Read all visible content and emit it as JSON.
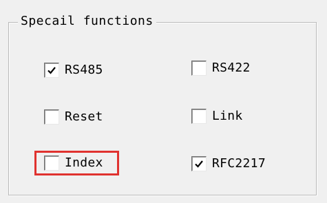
{
  "group": {
    "title": "Specail functions"
  },
  "checkboxes": [
    {
      "id": "rs485",
      "label": "RS485",
      "checked": true
    },
    {
      "id": "rs422",
      "label": "RS422",
      "checked": false
    },
    {
      "id": "reset",
      "label": "Reset",
      "checked": false
    },
    {
      "id": "link",
      "label": "Link",
      "checked": false
    },
    {
      "id": "index",
      "label": "Index",
      "checked": false
    },
    {
      "id": "rfc2217",
      "label": "RFC2217",
      "checked": true
    }
  ],
  "colors": {
    "highlight": "#e0322f",
    "background": "#f0f0f0"
  }
}
